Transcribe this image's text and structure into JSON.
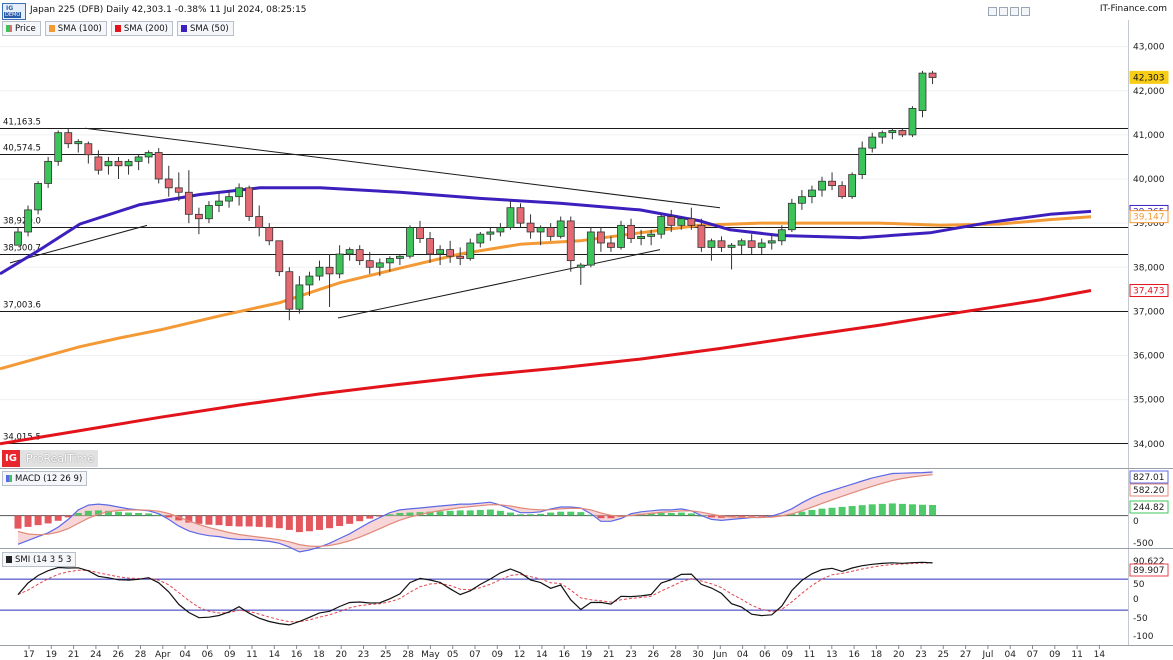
{
  "header": {
    "logo_top": "IG",
    "logo_bottom": "DEMO",
    "title": "Japan 225 (DFB) Daily 42,303.1 -0.38% 11 Jul 2024, 08:25:15",
    "brand": "IT-Finance.com"
  },
  "legend": [
    {
      "label": "Price",
      "color": "#3cc45a"
    },
    {
      "label": "SMA (100)",
      "color": "#f39a36"
    },
    {
      "label": "SMA (200)",
      "color": "#e2131a"
    },
    {
      "label": "SMA (50)",
      "color": "#3d1fbd"
    }
  ],
  "watermark": {
    "logo": "IG",
    "text": "ProRealTime"
  },
  "macd_panel": {
    "label": "MACD (12 26 9)"
  },
  "smi_panel": {
    "label": "SMI (14 3 5 3"
  },
  "colors": {
    "up": "#3cc45a",
    "down": "#e36a72",
    "sma50": "#3d1fbd",
    "sma100": "#f39a36",
    "sma200": "#e2131a",
    "macd_line": "#5b69e6",
    "signal_line": "#e08a7a",
    "hist_up": "#3cc45a",
    "hist_down": "#e0464e",
    "price_tag_bg": "#f7cd16"
  },
  "chart_data": [
    {
      "type": "candlestick",
      "title": "Japan 225 (DFB) Daily",
      "y_axis_ticks": [
        "43,000",
        "42,000",
        "41,000",
        "40,000",
        "39,000",
        "38,000",
        "37,000",
        "36,000",
        "35,000",
        "34,000"
      ],
      "ylim": [
        33950,
        43150
      ],
      "x_axis_ticks": [
        "17",
        "19",
        "21",
        "24",
        "26",
        "28",
        "Apr",
        "04",
        "06",
        "09",
        "11",
        "14",
        "16",
        "18",
        "20",
        "23",
        "25",
        "28",
        "May",
        "05",
        "07",
        "09",
        "12",
        "14",
        "16",
        "19",
        "21",
        "23",
        "26",
        "28",
        "30",
        "Jun",
        "04",
        "06",
        "09",
        "11",
        "13",
        "16",
        "18",
        "20",
        "23",
        "25",
        "27",
        "Jul",
        "04",
        "07",
        "09",
        "11",
        "14"
      ],
      "horizontal_levels": [
        {
          "label": "41,163.5",
          "value": 41163.5
        },
        {
          "label": "40,574.5",
          "value": 40574.5
        },
        {
          "label": "38,920.0",
          "value": 38920.0
        },
        {
          "label": "38,300.7",
          "value": 38300.7
        },
        {
          "label": "37,003.6",
          "value": 37003.6
        },
        {
          "label": "34,015.5",
          "value": 34015.5
        }
      ],
      "last_value_tags": [
        {
          "label": "42,303",
          "value": 42303,
          "series": "Price"
        },
        {
          "label": "39,265",
          "value": 39265,
          "series": "SMA (50)"
        },
        {
          "label": "39,147",
          "value": 39147,
          "series": "SMA (100)"
        },
        {
          "label": "37,473",
          "value": 37473,
          "series": "SMA (200)"
        }
      ],
      "candles_ohlc": [
        [
          38500,
          38900,
          38500,
          38800
        ],
        [
          38800,
          39400,
          38700,
          39300
        ],
        [
          39300,
          39950,
          39200,
          39900
        ],
        [
          39900,
          40500,
          39800,
          40400
        ],
        [
          40400,
          41100,
          40300,
          41050
        ],
        [
          41050,
          41150,
          40700,
          40800
        ],
        [
          40800,
          40900,
          40600,
          40850
        ],
        [
          40800,
          40850,
          40350,
          40550
        ],
        [
          40500,
          40650,
          40100,
          40200
        ],
        [
          40300,
          40500,
          40100,
          40400
        ],
        [
          40400,
          40500,
          40000,
          40300
        ],
        [
          40300,
          40450,
          40100,
          40400
        ],
        [
          40400,
          40550,
          40200,
          40500
        ],
        [
          40500,
          40650,
          40350,
          40600
        ],
        [
          40600,
          40700,
          39900,
          40000
        ],
        [
          40000,
          40300,
          39600,
          39800
        ],
        [
          39800,
          40150,
          39500,
          39700
        ],
        [
          39700,
          40200,
          39000,
          39200
        ],
        [
          39200,
          39350,
          38750,
          39100
        ],
        [
          39100,
          39500,
          39000,
          39400
        ],
        [
          39400,
          39700,
          39250,
          39500
        ],
        [
          39500,
          39750,
          39350,
          39600
        ],
        [
          39600,
          39900,
          39400,
          39800
        ],
        [
          39800,
          39850,
          39050,
          39150
        ],
        [
          39150,
          39400,
          38700,
          38900
        ],
        [
          38900,
          39000,
          38500,
          38600
        ],
        [
          38600,
          38600,
          37800,
          37900
        ],
        [
          37900,
          38000,
          36800,
          37050
        ],
        [
          37050,
          37800,
          36950,
          37600
        ],
        [
          37600,
          37900,
          37350,
          37800
        ],
        [
          37800,
          38150,
          37700,
          38000
        ],
        [
          38000,
          38300,
          37100,
          37850
        ],
        [
          37850,
          38500,
          37750,
          38300
        ],
        [
          38300,
          38450,
          38150,
          38400
        ],
        [
          38400,
          38500,
          38050,
          38150
        ],
        [
          38150,
          38350,
          37850,
          38000
        ],
        [
          38000,
          38200,
          37800,
          38100
        ],
        [
          38100,
          38250,
          37900,
          38200
        ],
        [
          38200,
          38300,
          38050,
          38250
        ],
        [
          38250,
          38950,
          38200,
          38900
        ],
        [
          38900,
          39050,
          38550,
          38650
        ],
        [
          38650,
          38800,
          38100,
          38300
        ],
        [
          38300,
          38500,
          38050,
          38400
        ],
        [
          38400,
          38600,
          38100,
          38250
        ],
        [
          38250,
          38450,
          38050,
          38200
        ],
        [
          38200,
          38650,
          38150,
          38550
        ],
        [
          38550,
          38800,
          38450,
          38750
        ],
        [
          38750,
          38900,
          38600,
          38800
        ],
        [
          38800,
          39000,
          38700,
          38900
        ],
        [
          38900,
          39500,
          38850,
          39350
        ],
        [
          39350,
          39450,
          38900,
          39000
        ],
        [
          39000,
          39200,
          38650,
          38800
        ],
        [
          38800,
          38950,
          38500,
          38900
        ],
        [
          38900,
          39000,
          38600,
          38700
        ],
        [
          38700,
          39150,
          38650,
          39050
        ],
        [
          39050,
          39150,
          37900,
          38150
        ],
        [
          38000,
          38100,
          37600,
          38050
        ],
        [
          38050,
          38900,
          38000,
          38800
        ],
        [
          38800,
          38900,
          38350,
          38550
        ],
        [
          38550,
          38700,
          38350,
          38450
        ],
        [
          38450,
          39050,
          38400,
          38950
        ],
        [
          38950,
          39100,
          38550,
          38650
        ],
        [
          38650,
          38850,
          38500,
          38700
        ],
        [
          38700,
          38850,
          38500,
          38750
        ],
        [
          38750,
          39200,
          38650,
          39150
        ],
        [
          39150,
          39300,
          38800,
          38950
        ],
        [
          38950,
          39150,
          38850,
          39100
        ],
        [
          39100,
          39350,
          38850,
          38950
        ],
        [
          38950,
          39100,
          38350,
          38450
        ],
        [
          38450,
          38650,
          38150,
          38600
        ],
        [
          38600,
          38700,
          38350,
          38450
        ],
        [
          38450,
          38550,
          37950,
          38500
        ],
        [
          38500,
          38650,
          38300,
          38600
        ],
        [
          38600,
          38750,
          38300,
          38450
        ],
        [
          38450,
          38650,
          38300,
          38550
        ],
        [
          38550,
          38750,
          38400,
          38600
        ],
        [
          38600,
          38950,
          38500,
          38850
        ],
        [
          38850,
          39550,
          38800,
          39450
        ],
        [
          39450,
          39750,
          39300,
          39600
        ],
        [
          39600,
          39850,
          39450,
          39750
        ],
        [
          39750,
          40050,
          39600,
          39950
        ],
        [
          39950,
          40150,
          39750,
          39850
        ],
        [
          39850,
          39950,
          39550,
          39600
        ],
        [
          39600,
          40150,
          39550,
          40100
        ],
        [
          40100,
          40850,
          40000,
          40700
        ],
        [
          40700,
          41050,
          40600,
          40950
        ],
        [
          40950,
          41100,
          40800,
          41050
        ],
        [
          41050,
          41150,
          40900,
          41100
        ],
        [
          41100,
          41150,
          40950,
          41000
        ],
        [
          41000,
          41650,
          40950,
          41600
        ],
        [
          41550,
          42450,
          41400,
          42400
        ],
        [
          42400,
          42450,
          42150,
          42300
        ]
      ],
      "sma50": [
        [
          0,
          37850
        ],
        [
          40,
          38400
        ],
        [
          80,
          38980
        ],
        [
          140,
          39420
        ],
        [
          200,
          39650
        ],
        [
          260,
          39800
        ],
        [
          320,
          39800
        ],
        [
          400,
          39700
        ],
        [
          480,
          39560
        ],
        [
          560,
          39450
        ],
        [
          640,
          39300
        ],
        [
          700,
          39050
        ],
        [
          730,
          38850
        ],
        [
          780,
          38720
        ],
        [
          860,
          38670
        ],
        [
          930,
          38780
        ],
        [
          990,
          39020
        ],
        [
          1050,
          39200
        ],
        [
          1091,
          39265
        ]
      ],
      "sma100": [
        [
          0,
          35700
        ],
        [
          40,
          35950
        ],
        [
          80,
          36200
        ],
        [
          120,
          36400
        ],
        [
          160,
          36580
        ],
        [
          220,
          36900
        ],
        [
          280,
          37200
        ],
        [
          340,
          37650
        ],
        [
          400,
          37980
        ],
        [
          460,
          38300
        ],
        [
          520,
          38520
        ],
        [
          580,
          38600
        ],
        [
          640,
          38780
        ],
        [
          700,
          38950
        ],
        [
          760,
          39000
        ],
        [
          820,
          39000
        ],
        [
          880,
          39000
        ],
        [
          940,
          38950
        ],
        [
          1000,
          38980
        ],
        [
          1050,
          39080
        ],
        [
          1091,
          39147
        ]
      ],
      "sma200": [
        [
          0,
          34000
        ],
        [
          80,
          34300
        ],
        [
          160,
          34600
        ],
        [
          240,
          34880
        ],
        [
          320,
          35130
        ],
        [
          400,
          35350
        ],
        [
          480,
          35550
        ],
        [
          560,
          35720
        ],
        [
          640,
          35920
        ],
        [
          720,
          36160
        ],
        [
          800,
          36430
        ],
        [
          880,
          36690
        ],
        [
          960,
          36980
        ],
        [
          1040,
          37260
        ],
        [
          1091,
          37473
        ]
      ],
      "trendlines_price": [
        [
          [
            10,
            38100
          ],
          [
            147,
            38950
          ]
        ],
        [
          [
            85,
            41150
          ],
          [
            720,
            39350
          ]
        ],
        [
          [
            338,
            36850
          ],
          [
            660,
            38400
          ]
        ]
      ]
    },
    {
      "type": "bar+line",
      "title": "MACD (12 26 9)",
      "y_axis_ticks": [
        "827.01",
        "582.20",
        "244.82",
        "0",
        "-500"
      ],
      "last_value_tags": [
        {
          "label": "827.01",
          "value": 827.01,
          "series": "MACD"
        },
        {
          "label": "582.20",
          "value": 582.2,
          "series": "Signal"
        },
        {
          "label": "244.82",
          "value": 244.82,
          "series": "Histogram"
        }
      ],
      "ylim": [
        -700,
        1050
      ],
      "histogram": [
        -300,
        -260,
        -220,
        -180,
        -120,
        -40,
        60,
        110,
        120,
        110,
        90,
        70,
        60,
        50,
        20,
        -40,
        -110,
        -160,
        -190,
        -210,
        -220,
        -240,
        -250,
        -250,
        -260,
        -270,
        -290,
        -330,
        -380,
        -360,
        -330,
        -290,
        -240,
        -190,
        -130,
        -70,
        -20,
        30,
        60,
        70,
        80,
        90,
        100,
        110,
        120,
        120,
        130,
        140,
        110,
        70,
        30,
        30,
        40,
        70,
        90,
        90,
        80,
        20,
        -60,
        -60,
        -30,
        20,
        40,
        50,
        60,
        60,
        70,
        50,
        0,
        -40,
        -50,
        -40,
        -30,
        -20,
        -20,
        -10,
        10,
        40,
        90,
        130,
        160,
        180,
        200,
        220,
        240,
        260,
        270,
        280,
        270,
        260,
        250,
        244
      ]
    },
    {
      "type": "line",
      "title": "SMI (14 3 5 3",
      "y_axis_ticks": [
        "90.622",
        "89.907",
        "50",
        "0",
        "-50",
        "-100"
      ],
      "last_value_tags": [
        {
          "label": "90.622",
          "value": 90.622,
          "series": "SMI"
        },
        {
          "label": "89.907",
          "value": 89.907,
          "series": "Signal"
        }
      ],
      "ylim": [
        -125,
        115
      ],
      "reference_lines": [
        40,
        -40
      ]
    }
  ]
}
